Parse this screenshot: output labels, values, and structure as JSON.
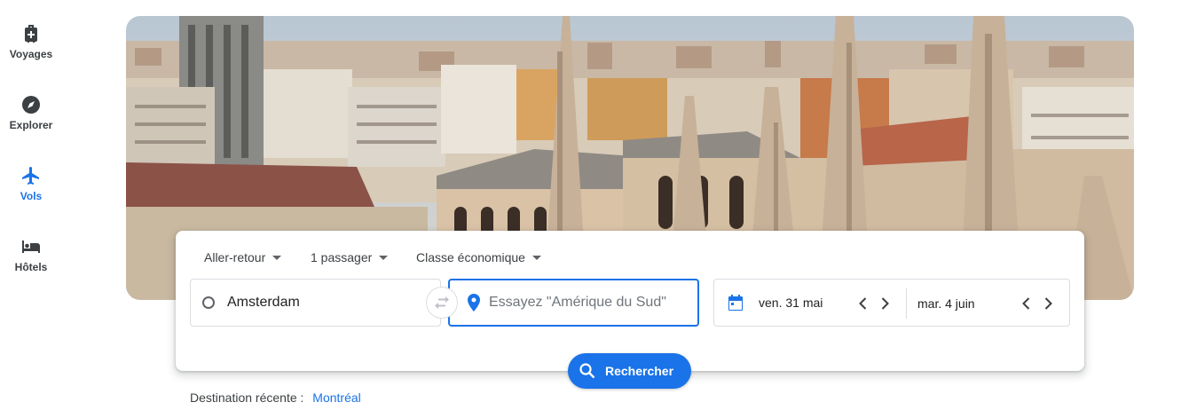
{
  "nav": {
    "items": [
      {
        "label": "Voyages",
        "icon": "suitcase-icon"
      },
      {
        "label": "Explorer",
        "icon": "compass-icon"
      },
      {
        "label": "Vols",
        "icon": "airplane-icon",
        "active": true
      },
      {
        "label": "Hôtels",
        "icon": "bed-icon"
      }
    ]
  },
  "search": {
    "trip_type": "Aller-retour",
    "passengers": "1 passager",
    "cabin_class": "Classe économique",
    "origin_value": "Amsterdam",
    "destination_placeholder": "Essayez \"Amérique du Sud\"",
    "depart_date": "ven. 31 mai",
    "return_date": "mar. 4 juin",
    "button_label": "Rechercher"
  },
  "recent": {
    "label": "Destination récente :",
    "link": "Montréal"
  },
  "colors": {
    "accent": "#1a73e8",
    "text": "#3c4043"
  }
}
